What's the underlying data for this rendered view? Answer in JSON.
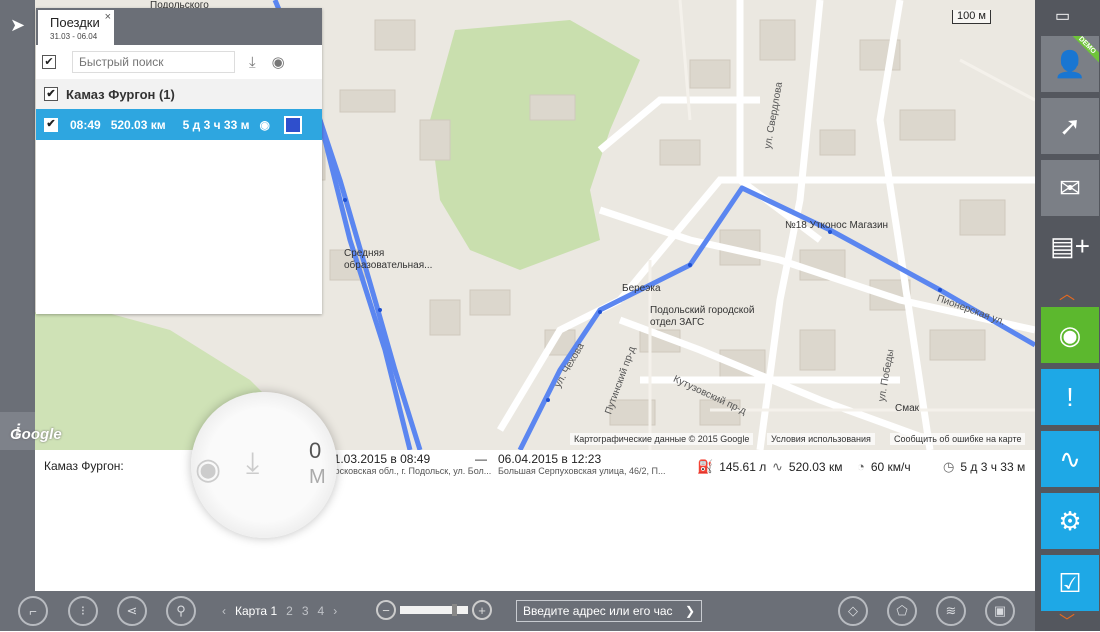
{
  "map": {
    "scale_label": "100 м",
    "google_label": "Google",
    "attribution": [
      "Картографические данные © 2015 Google",
      "Условия использования",
      "Сообщить об ошибке на карте"
    ],
    "pois": [
      "№18 Утконос Магазин",
      "Береэка",
      "Подольский городской отдел ЗАГС",
      "Средняя образовательная...",
      "Смак",
      "Подольского"
    ],
    "streets": [
      "ул. Свердлова",
      "Пионерская ул.",
      "ул. Победы",
      "Кутузовский пр-д",
      "Путинский пр-д",
      "ул. Чехова"
    ],
    "route_color": "#5b86f0"
  },
  "trips_panel": {
    "tab_title": "Поездки",
    "tab_dates": "31.03 - 06.04",
    "close": "×",
    "search_placeholder": "Быстрый поиск",
    "group_label": "Камаз Фургон (1)",
    "trip": {
      "time": "08:49",
      "distance": "520.03 км",
      "duration": "5 д 3 ч 33 м",
      "color": "#2f4fcc"
    }
  },
  "info": {
    "vehicle_label": "Камаз Фургон:",
    "magnifier_big": "0",
    "magnifier_big2": "М",
    "start_datetime": "31.03.2015 в 08:49",
    "start_address": "Московская обл., г. Подольск, ул. Бол...",
    "dash": "—",
    "end_datetime": "06.04.2015 в 12:23",
    "end_address": "Большая Серпуховская улица, 46/2, П...",
    "fuel": "145.61 л",
    "distance": "520.03 км",
    "speed": "60 км/ч",
    "duration": "5 д 3 ч 33 м"
  },
  "toolbar": {
    "map_label": "Карта 1",
    "pages": [
      "2",
      "3",
      "4"
    ],
    "zoom_level": 0.82,
    "address_placeholder": "Введите адрес или его час"
  },
  "sidebar": {
    "deno_badge": "DEMO"
  }
}
